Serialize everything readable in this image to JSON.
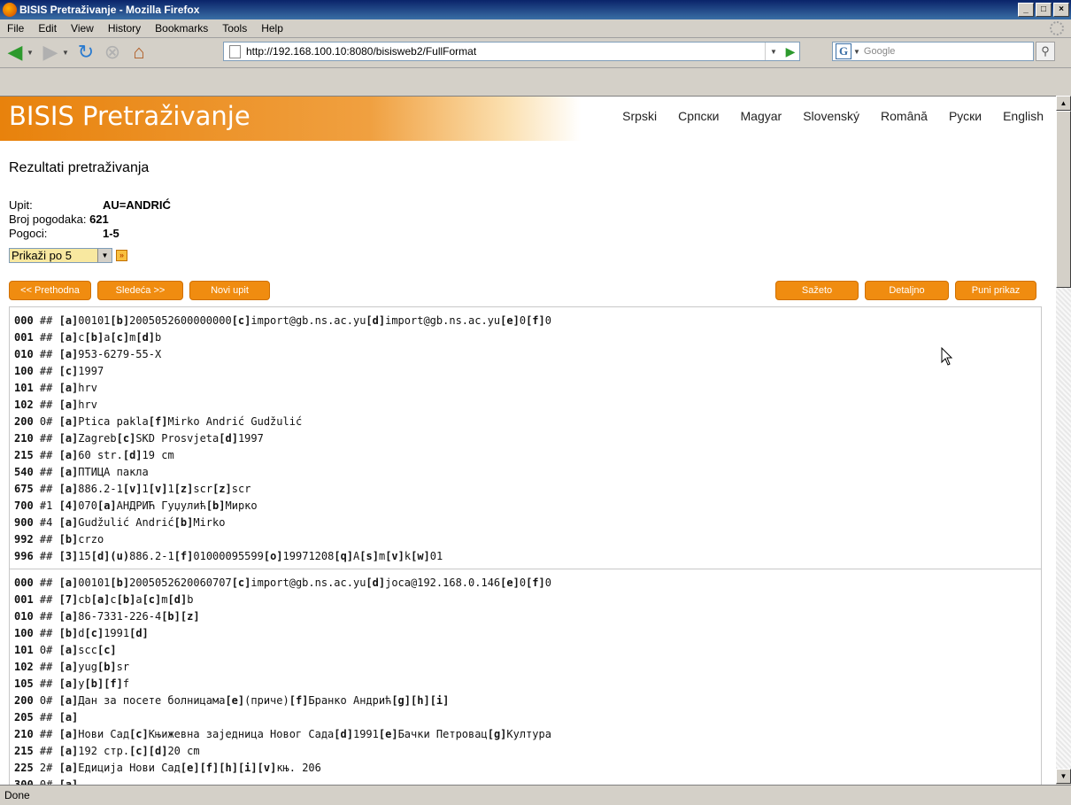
{
  "window": {
    "title": "BISIS Pretraživanje - Mozilla Firefox"
  },
  "menu": [
    "File",
    "Edit",
    "View",
    "History",
    "Bookmarks",
    "Tools",
    "Help"
  ],
  "address": {
    "url": "http://192.168.100.10:8080/bisisweb2/FullFormat"
  },
  "search": {
    "placeholder": "Google"
  },
  "site": {
    "logo": "BISIS Pretraživanje",
    "languages": [
      "Srpski",
      "Српски",
      "Magyar",
      "Slovenský",
      "Română",
      "Руски",
      "English"
    ]
  },
  "results": {
    "heading": "Rezultati pretraživanja",
    "query_label": "Upit:",
    "query_value": "AU=ANDRIĆ",
    "count_label": "Broj pogodaka:",
    "count_value": "621",
    "hits_label": "Pogoci:",
    "hits_value": "1-5",
    "per_page": "Prikaži po 5"
  },
  "buttons": {
    "prev": "<< Prethodna",
    "next": "Sledeća >>",
    "new_query": "Novi upit",
    "short": "Sažeto",
    "detailed": "Detaljno",
    "full": "Puni prikaz"
  },
  "records": [
    [
      [
        [
          "000",
          true
        ],
        [
          " ## ",
          false
        ],
        [
          "[a]",
          true
        ],
        [
          "00101",
          false
        ],
        [
          "[b]",
          true
        ],
        [
          "2005052600000000",
          false
        ],
        [
          "[c]",
          true
        ],
        [
          "import@gb.ns.ac.yu",
          false
        ],
        [
          "[d]",
          true
        ],
        [
          "import@gb.ns.ac.yu",
          false
        ],
        [
          "[e]",
          true
        ],
        [
          "0",
          false
        ],
        [
          "[f]",
          true
        ],
        [
          "0",
          false
        ]
      ],
      [
        [
          "001",
          true
        ],
        [
          " ## ",
          false
        ],
        [
          "[a]",
          true
        ],
        [
          "c",
          false
        ],
        [
          "[b]",
          true
        ],
        [
          "a",
          false
        ],
        [
          "[c]",
          true
        ],
        [
          "m",
          false
        ],
        [
          "[d]",
          true
        ],
        [
          "b",
          false
        ]
      ],
      [
        [
          "010",
          true
        ],
        [
          " ## ",
          false
        ],
        [
          "[a]",
          true
        ],
        [
          "953-6279-55-X",
          false
        ]
      ],
      [
        [
          "100",
          true
        ],
        [
          " ## ",
          false
        ],
        [
          "[c]",
          true
        ],
        [
          "1997",
          false
        ]
      ],
      [
        [
          "101",
          true
        ],
        [
          " ## ",
          false
        ],
        [
          "[a]",
          true
        ],
        [
          "hrv",
          false
        ]
      ],
      [
        [
          "102",
          true
        ],
        [
          " ## ",
          false
        ],
        [
          "[a]",
          true
        ],
        [
          "hrv",
          false
        ]
      ],
      [
        [
          "200",
          true
        ],
        [
          " 0# ",
          false
        ],
        [
          "[a]",
          true
        ],
        [
          "Ptica pakla",
          false
        ],
        [
          "[f]",
          true
        ],
        [
          "Mirko Andrić Gudžulić",
          false
        ]
      ],
      [
        [
          "210",
          true
        ],
        [
          " ## ",
          false
        ],
        [
          "[a]",
          true
        ],
        [
          "Zagreb",
          false
        ],
        [
          "[c]",
          true
        ],
        [
          "SKD Prosvjeta",
          false
        ],
        [
          "[d]",
          true
        ],
        [
          "1997",
          false
        ]
      ],
      [
        [
          "215",
          true
        ],
        [
          " ## ",
          false
        ],
        [
          "[a]",
          true
        ],
        [
          "60 str.",
          false
        ],
        [
          "[d]",
          true
        ],
        [
          "19 cm",
          false
        ]
      ],
      [
        [
          "540",
          true
        ],
        [
          " ## ",
          false
        ],
        [
          "[a]",
          true
        ],
        [
          "ПТИЦА пакла",
          false
        ]
      ],
      [
        [
          "675",
          true
        ],
        [
          " ## ",
          false
        ],
        [
          "[a]",
          true
        ],
        [
          "886.2-1",
          false
        ],
        [
          "[v]",
          true
        ],
        [
          "1",
          false
        ],
        [
          "[v]",
          true
        ],
        [
          "1",
          false
        ],
        [
          "[z]",
          true
        ],
        [
          "scr",
          false
        ],
        [
          "[z]",
          true
        ],
        [
          "scr",
          false
        ]
      ],
      [
        [
          "700",
          true
        ],
        [
          " #1 ",
          false
        ],
        [
          "[4]",
          true
        ],
        [
          "070",
          false
        ],
        [
          "[a]",
          true
        ],
        [
          "АНДРИЋ Гуџулић",
          false
        ],
        [
          "[b]",
          true
        ],
        [
          "Мирко",
          false
        ]
      ],
      [
        [
          "900",
          true
        ],
        [
          " #4 ",
          false
        ],
        [
          "[a]",
          true
        ],
        [
          "Gudžulić Andrić",
          false
        ],
        [
          "[b]",
          true
        ],
        [
          "Mirko",
          false
        ]
      ],
      [
        [
          "992",
          true
        ],
        [
          " ## ",
          false
        ],
        [
          "[b]",
          true
        ],
        [
          "crzo",
          false
        ]
      ],
      [
        [
          "996",
          true
        ],
        [
          " ## ",
          false
        ],
        [
          "[3]",
          true
        ],
        [
          "15",
          false
        ],
        [
          "[d]",
          true
        ],
        [
          "(u)",
          true
        ],
        [
          "886.2-1",
          false
        ],
        [
          "[f]",
          true
        ],
        [
          "01000095599",
          false
        ],
        [
          "[o]",
          true
        ],
        [
          "19971208",
          false
        ],
        [
          "[q]",
          true
        ],
        [
          "A",
          false
        ],
        [
          "[s]",
          true
        ],
        [
          "m",
          false
        ],
        [
          "[v]",
          true
        ],
        [
          "k",
          false
        ],
        [
          "[w]",
          true
        ],
        [
          "01",
          false
        ]
      ]
    ],
    [
      [
        [
          "000",
          true
        ],
        [
          " ## ",
          false
        ],
        [
          "[a]",
          true
        ],
        [
          "00101",
          false
        ],
        [
          "[b]",
          true
        ],
        [
          "2005052620060707",
          false
        ],
        [
          "[c]",
          true
        ],
        [
          "import@gb.ns.ac.yu",
          false
        ],
        [
          "[d]",
          true
        ],
        [
          "joca@192.168.0.146",
          false
        ],
        [
          "[e]",
          true
        ],
        [
          "0",
          false
        ],
        [
          "[f]",
          true
        ],
        [
          "0",
          false
        ]
      ],
      [
        [
          "001",
          true
        ],
        [
          " ## ",
          false
        ],
        [
          "[7]",
          true
        ],
        [
          "cb",
          false
        ],
        [
          "[a]",
          true
        ],
        [
          "c",
          false
        ],
        [
          "[b]",
          true
        ],
        [
          "a",
          false
        ],
        [
          "[c]",
          true
        ],
        [
          "m",
          false
        ],
        [
          "[d]",
          true
        ],
        [
          "b",
          false
        ]
      ],
      [
        [
          "010",
          true
        ],
        [
          " ## ",
          false
        ],
        [
          "[a]",
          true
        ],
        [
          "86-7331-226-4",
          false
        ],
        [
          "[b]",
          true
        ],
        [
          "[z]",
          true
        ]
      ],
      [
        [
          "100",
          true
        ],
        [
          " ## ",
          false
        ],
        [
          "[b]",
          true
        ],
        [
          "d",
          false
        ],
        [
          "[c]",
          true
        ],
        [
          "1991",
          false
        ],
        [
          "[d]",
          true
        ]
      ],
      [
        [
          "101",
          true
        ],
        [
          " 0# ",
          false
        ],
        [
          "[a]",
          true
        ],
        [
          "scc",
          false
        ],
        [
          "[c]",
          true
        ]
      ],
      [
        [
          "102",
          true
        ],
        [
          " ## ",
          false
        ],
        [
          "[a]",
          true
        ],
        [
          "yug",
          false
        ],
        [
          "[b]",
          true
        ],
        [
          "sr",
          false
        ]
      ],
      [
        [
          "105",
          true
        ],
        [
          " ## ",
          false
        ],
        [
          "[a]",
          true
        ],
        [
          "y",
          false
        ],
        [
          "[b]",
          true
        ],
        [
          "[f]",
          true
        ],
        [
          "f",
          false
        ]
      ],
      [
        [
          "200",
          true
        ],
        [
          " 0# ",
          false
        ],
        [
          "[a]",
          true
        ],
        [
          "Дан за посете болницама",
          false
        ],
        [
          "[e]",
          true
        ],
        [
          "(приче)",
          false
        ],
        [
          "[f]",
          true
        ],
        [
          "Бранко Андрић",
          false
        ],
        [
          "[g]",
          true
        ],
        [
          "[h]",
          true
        ],
        [
          "[i]",
          true
        ]
      ],
      [
        [
          "205",
          true
        ],
        [
          " ## ",
          false
        ],
        [
          "[a]",
          true
        ]
      ],
      [
        [
          "210",
          true
        ],
        [
          " ## ",
          false
        ],
        [
          "[a]",
          true
        ],
        [
          "Нови Сад",
          false
        ],
        [
          "[c]",
          true
        ],
        [
          "Књижевна заједница Новог Сада",
          false
        ],
        [
          "[d]",
          true
        ],
        [
          "1991",
          false
        ],
        [
          "[e]",
          true
        ],
        [
          "Бачки Петровац",
          false
        ],
        [
          "[g]",
          true
        ],
        [
          "Култура",
          false
        ]
      ],
      [
        [
          "215",
          true
        ],
        [
          " ## ",
          false
        ],
        [
          "[a]",
          true
        ],
        [
          "192 стр.",
          false
        ],
        [
          "[c]",
          true
        ],
        [
          "[d]",
          true
        ],
        [
          "20 cm",
          false
        ]
      ],
      [
        [
          "225",
          true
        ],
        [
          " 2# ",
          false
        ],
        [
          "[a]",
          true
        ],
        [
          "Едиција Нови Сад",
          false
        ],
        [
          "[e]",
          true
        ],
        [
          "[f]",
          true
        ],
        [
          "[h]",
          true
        ],
        [
          "[i]",
          true
        ],
        [
          "[v]",
          true
        ],
        [
          "књ. 206",
          false
        ]
      ],
      [
        [
          "300",
          true
        ],
        [
          " 0# ",
          false
        ],
        [
          "[a]",
          true
        ]
      ]
    ]
  ],
  "status": {
    "text": "Done"
  }
}
